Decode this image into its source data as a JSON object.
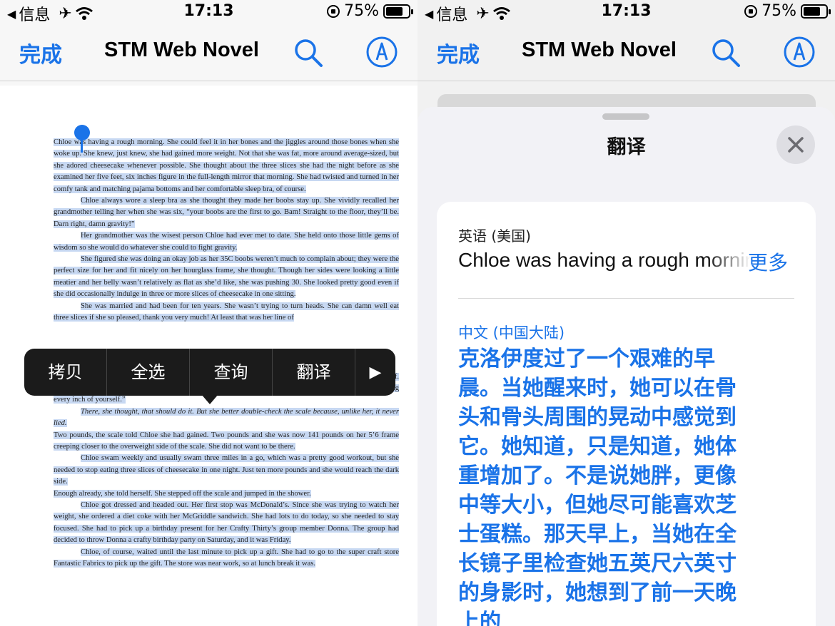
{
  "status_bar": {
    "back_label": "信息",
    "time": "17:13",
    "battery_percent": "75%",
    "battery_level": 0.75
  },
  "left": {
    "nav": {
      "done": "完成",
      "title": "STM Web Novel",
      "search_icon": "search-icon",
      "markup_icon": "markup-pen-icon"
    },
    "document": {
      "paragraphs": [
        "Chloe was having a rough morning. She could feel it in her bones and the jiggles around those bones when she woke up. She knew, just knew, she had gained more weight. Not that she was fat, more around average-sized, but she adored cheesecake whenever possible. She thought about the three slices she had the night before as she examined her five feet, six inches figure in the full-length mirror that morning. She had twisted and turned in her comfy tank and matching pajama bottoms and her comfortable sleep bra, of course.",
        "Chloe always wore a sleep bra as she thought they made her boobs stay up. She vividly recalled her grandmother telling her when she was six, “your boobs are the first to go. Bam! Straight to the floor, they’ll be. Darn right, damn gravity!”",
        "Her grandmother was the wisest person Chloe had ever met to date. She held onto those little gems of wisdom so she would do whatever she could to fight gravity.",
        "She figured she was doing an okay job as her 35C boobs weren’t much to complain about; they were the perfect size for her and fit nicely on her hourglass frame, she thought. Though her sides were looking a little meatier and her belly wasn’t relatively as flat as she’d like, she was pushing 30. She looked pretty good even if she did occasionally indulge in three or more slices of cheesecake in one sitting.",
        "She was married and had been for ten years. She wasn’t trying to turn heads. She can damn well eat three slices if she so pleased, thank you very much! At least that was her line of",
        "a few times until it finally freed her head shaped face so she could have her morning heart to heart with herself. She again looked into her eyes and said, “you are not fat. You are beautiful, and you will leave this room loving every inch of yourself.”",
        "There, she thought, that should do it. But she better double-check the scale because, unlike her, it never lied.",
        "Two pounds, the scale told Chloe she had gained. Two pounds and she was now 141 pounds on her 5’6 frame creeping closer to the overweight side of the scale. She did not want to be there.",
        "Chloe swam weekly and usually swam three miles in a go, which was a pretty good workout, but she needed to stop eating three slices of cheesecake in one night. Just ten more pounds and she would reach the dark side.",
        "Enough already, she told herself. She stepped off the scale and jumped in the shower.",
        "Chloe got dressed and headed out. Her first stop was McDonald’s. Since she was trying to watch her weight, she ordered a diet coke with her McGriddle sandwich. She had lots to do today, so she needed to stay focused. She had to pick up a birthday present for her Crafty Thirty’s group member Donna. The group had decided to throw Donna a crafty birthday party on Saturday, and it was Friday.",
        "Chloe, of course, waited until the last minute to pick up a gift. She had to go to the super craft store Fantastic Fabrics to pick up the gift. The store was near work, so at lunch break it was."
      ]
    },
    "context_menu": {
      "items": [
        "拷贝",
        "全选",
        "查询",
        "翻译"
      ],
      "more_icon": "play-triangle-icon"
    }
  },
  "right": {
    "nav": {
      "done": "完成",
      "title": "STM Web Novel",
      "search_icon": "search-icon",
      "markup_icon": "markup-pen-icon"
    },
    "sheet": {
      "title": "翻译",
      "close_icon": "close-icon",
      "source_language": "英语 (美国)",
      "source_text": "Chloe was having a rough morning",
      "more_label": "更多",
      "target_language": "中文 (中国大陆)",
      "target_text": "克洛伊度过了一个艰难的早晨。当她醒来时，她可以在骨头和骨头周围的晃动中感觉到它。她知道，只是知道，她体重增加了。不是说她胖，更像中等大小，但她尽可能喜欢芝士蛋糕。那天早上，当她在全长镜子里检查她五英尺六英寸的身影时，她想到了前一天晚上的"
    }
  },
  "colors": {
    "accent": "#1a73e8",
    "selection": "#c7d8f2",
    "menu_bg": "#1b1b1b"
  }
}
